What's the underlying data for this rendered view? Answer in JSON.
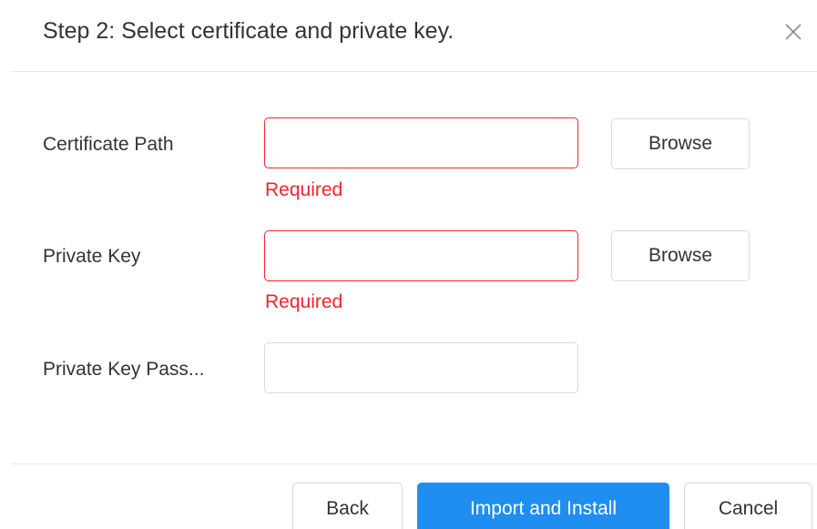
{
  "dialog": {
    "title": "Step 2: Select certificate and private key.",
    "close_label": "Close"
  },
  "form": {
    "certificate_path": {
      "label": "Certificate Path",
      "value": "",
      "placeholder": "",
      "error": "Required",
      "browse_label": "Browse"
    },
    "private_key": {
      "label": "Private Key",
      "value": "",
      "placeholder": "",
      "error": "Required",
      "browse_label": "Browse"
    },
    "private_key_password": {
      "label": "Private Key Pass...",
      "value": "",
      "placeholder": ""
    }
  },
  "footer": {
    "back_label": "Back",
    "import_label": "Import and Install",
    "cancel_label": "Cancel"
  },
  "colors": {
    "primary": "#1e8ef0",
    "error": "#f5222d",
    "border": "#d9d9d9",
    "text": "#333333"
  },
  "icons": {
    "close": "close-icon"
  }
}
